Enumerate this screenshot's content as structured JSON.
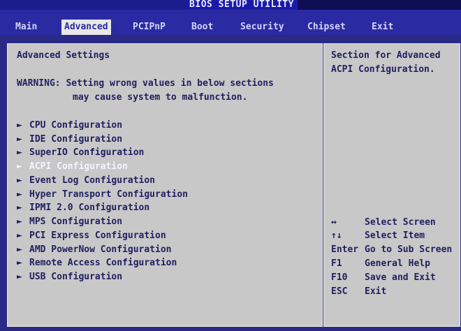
{
  "title": "BIOS SETUP UTILITY",
  "menu": [
    {
      "label": "Main",
      "active": false
    },
    {
      "label": "Advanced",
      "active": true
    },
    {
      "label": "PCIPnP",
      "active": false
    },
    {
      "label": "Boot",
      "active": false
    },
    {
      "label": "Security",
      "active": false
    },
    {
      "label": "Chipset",
      "active": false
    },
    {
      "label": "Exit",
      "active": false
    }
  ],
  "left": {
    "heading": "Advanced Settings",
    "warning_line1": "WARNING: Setting wrong values in below sections",
    "warning_line2": "may cause system to malfunction.",
    "arrow_char": "►",
    "items": [
      "CPU Configuration",
      "IDE Configuration",
      "SuperIO Configuration",
      "ACPI Configuration",
      "Event Log Configuration",
      "Hyper Transport Configuration",
      "IPMI 2.0 Configuration",
      "MPS Configuration",
      "PCI Express Configuration",
      "AMD PowerNow Configuration",
      "Remote Access Configuration",
      "USB Configuration"
    ],
    "selected_item": "ACPI Configuration"
  },
  "right": {
    "help_line1": "Section for Advanced",
    "help_line2": "ACPI Configuration.",
    "keys": [
      {
        "key": "↔",
        "action": "Select Screen"
      },
      {
        "key": "↑↓",
        "action": "Select Item"
      },
      {
        "key": "Enter",
        "action": "Go to Sub Screen"
      },
      {
        "key": "F1",
        "action": "General Help"
      },
      {
        "key": "F10",
        "action": "Save and Exit"
      },
      {
        "key": "ESC",
        "action": "Exit"
      }
    ]
  },
  "colors": {
    "background": "#2a2a86",
    "panel": "#c8c8c8",
    "text": "#202060",
    "highlight_text": "#f4f4ff",
    "menu_active_bg": "#e8e8e8"
  }
}
